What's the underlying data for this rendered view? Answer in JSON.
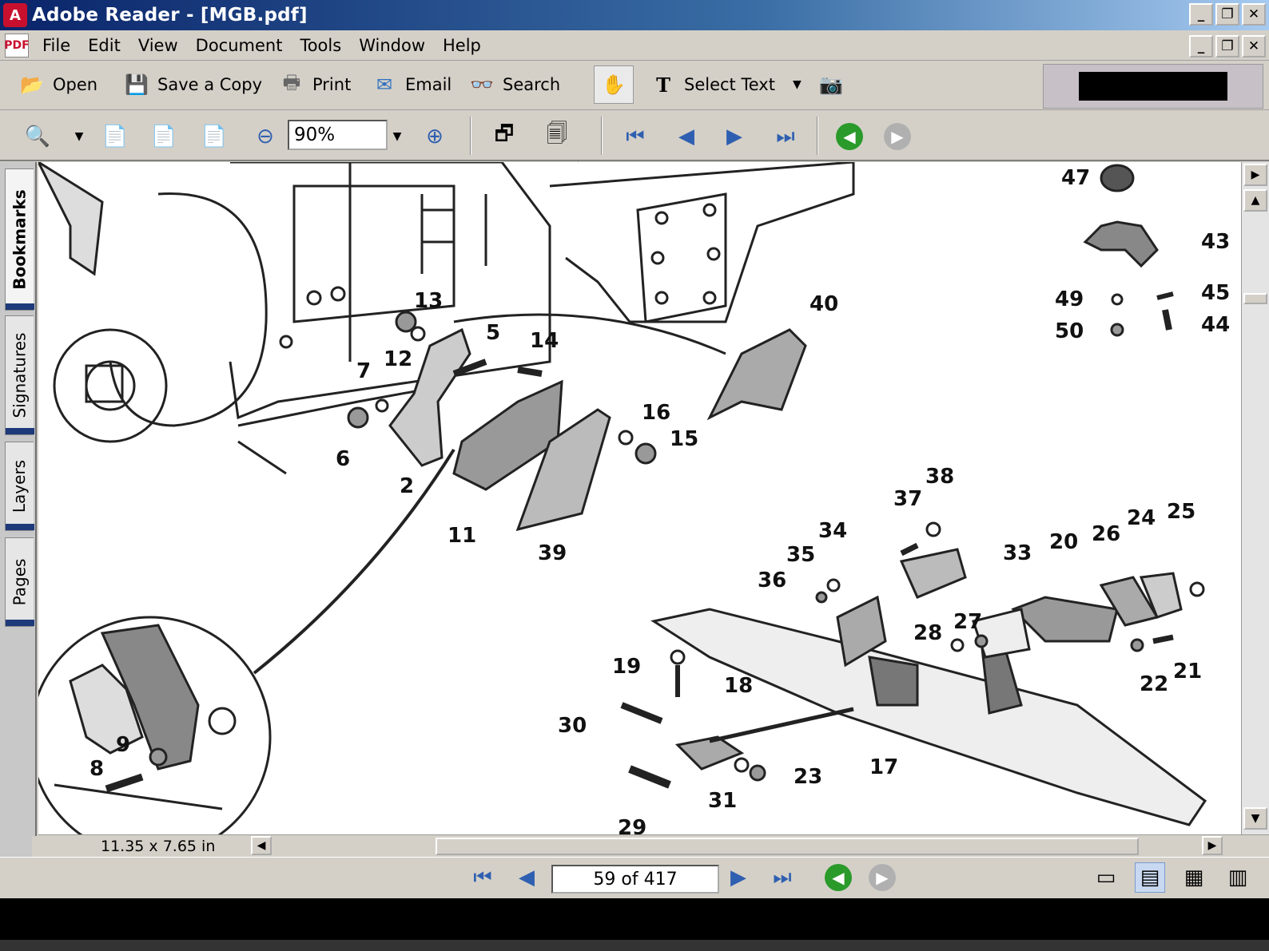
{
  "window": {
    "title": "Adobe Reader - [MGB.pdf]",
    "app_icon": "adobe-reader-icon"
  },
  "menu": [
    "File",
    "Edit",
    "View",
    "Document",
    "Tools",
    "Window",
    "Help"
  ],
  "toolbar": {
    "open": "Open",
    "save_copy": "Save a Copy",
    "print": "Print",
    "email": "Email",
    "search": "Search",
    "select_text": "Select Text"
  },
  "zoom": {
    "value": "90%"
  },
  "nav_tabs": [
    "Bookmarks",
    "Signatures",
    "Layers",
    "Pages"
  ],
  "status": {
    "page_size": "11.35 x 7.65 in"
  },
  "page_nav": {
    "current": "59 of 417"
  },
  "diagram": {
    "callouts": [
      "47",
      "43",
      "49",
      "45",
      "50",
      "44",
      "40",
      "13",
      "5",
      "14",
      "12",
      "7",
      "6",
      "2",
      "11",
      "39",
      "16",
      "15",
      "38",
      "37",
      "34",
      "35",
      "36",
      "33",
      "20",
      "26",
      "24",
      "25",
      "28",
      "27",
      "19",
      "18",
      "30",
      "23",
      "17",
      "31",
      "22",
      "21",
      "29",
      "9",
      "8"
    ]
  },
  "colors": {
    "titlebar_start": "#0a246a",
    "titlebar_end": "#a6caf0",
    "chrome": "#d4d0c8",
    "nav_marker": "#1e3a7a"
  }
}
